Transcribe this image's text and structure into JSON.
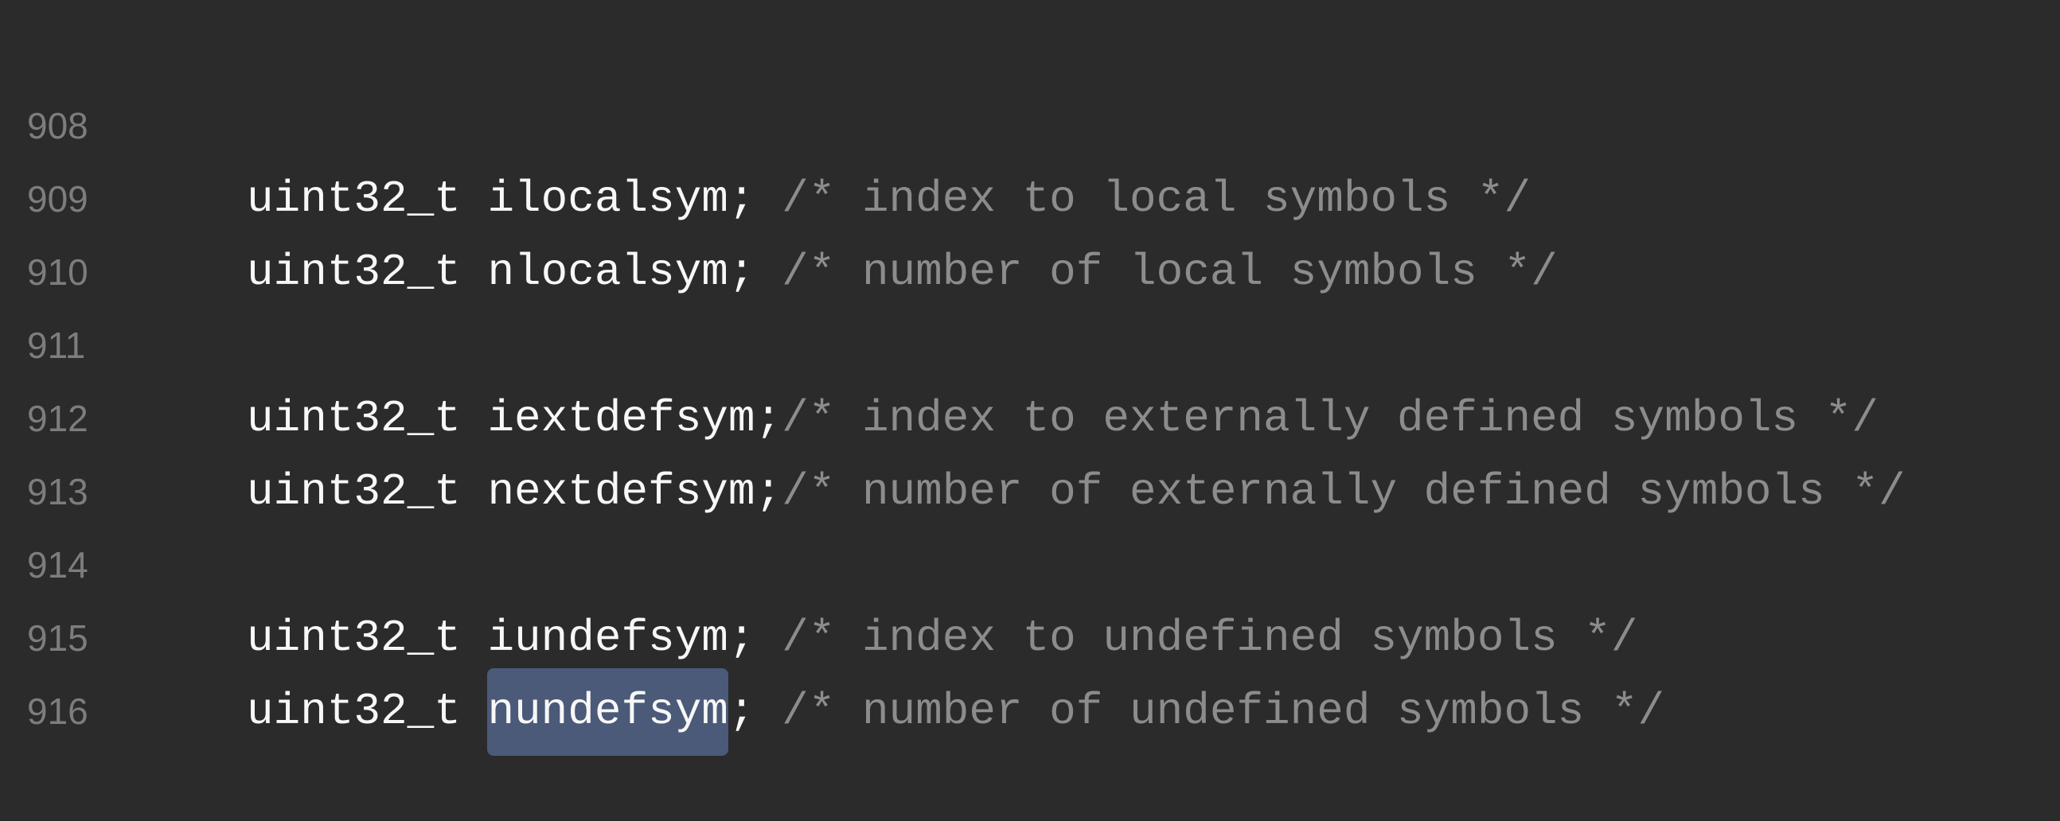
{
  "editor": {
    "lines": [
      {
        "number": "908",
        "type": "uint32_t ",
        "name": "ilocalsym",
        "sep": "; ",
        "comment": "/* index to local symbols */"
      },
      {
        "number": "909",
        "type": "uint32_t ",
        "name": "nlocalsym",
        "sep": "; ",
        "comment": "/* number of local symbols */"
      },
      {
        "number": "910"
      },
      {
        "number": "911",
        "type": "uint32_t ",
        "name": "iextdefsym",
        "sep": ";",
        "comment": "/* index to externally defined symbols */"
      },
      {
        "number": "912",
        "type": "uint32_t ",
        "name": "nextdefsym",
        "sep": ";",
        "comment": "/* number of externally defined symbols */"
      },
      {
        "number": "913"
      },
      {
        "number": "914",
        "type": "uint32_t ",
        "name": "iundefsym",
        "sep": "; ",
        "comment": "/* index to undefined symbols */"
      },
      {
        "number": "915",
        "type": "uint32_t ",
        "name": "nundefsym",
        "sep": "; ",
        "comment": "/* number of undefined symbols */",
        "highlighted": true
      },
      {
        "number": "916"
      }
    ],
    "colors": {
      "background": "#2b2b2b",
      "highlight": "#4a5a78",
      "comment": "#8c8c8c",
      "line_number": "#7d7d7d"
    }
  }
}
